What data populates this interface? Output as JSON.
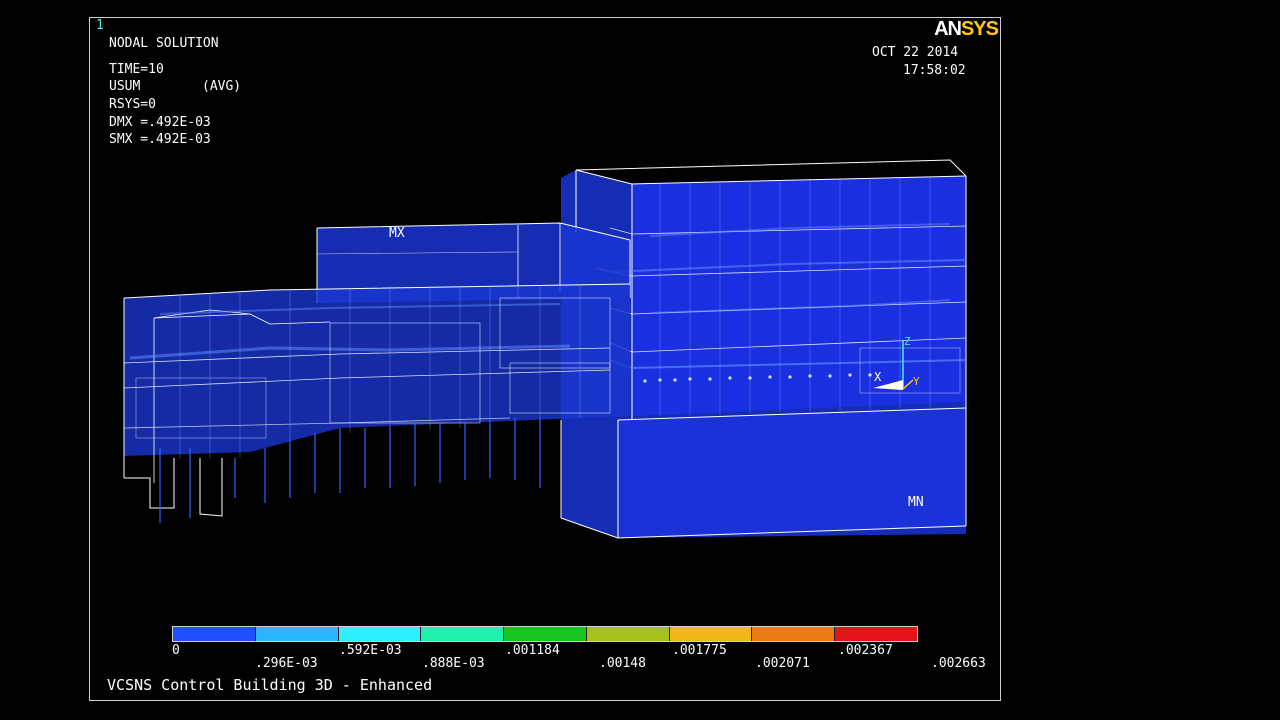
{
  "window": {
    "number": "1",
    "logo_an": "AN",
    "logo_sys": "SYS"
  },
  "header": {
    "title": "NODAL SOLUTION",
    "time": "TIME=10",
    "usum": "USUM",
    "avg": "(AVG)",
    "rsys": "RSYS=0",
    "dmx": "DMX =.492E-03",
    "smx": "SMX =.492E-03",
    "date": "OCT 22 2014",
    "clock": "17:58:02"
  },
  "markers": {
    "max": "MX",
    "min": "MN",
    "axis_x": "X",
    "axis_y": "Y",
    "axis_z": "Z"
  },
  "legend": {
    "colors": [
      "#1f4fff",
      "#29b7ff",
      "#2cf0ff",
      "#1ff0b0",
      "#14c61e",
      "#a6c21d",
      "#f1b617",
      "#ee7a15",
      "#e5141b"
    ],
    "labels_bottom_row": [
      "0",
      ".592E-03",
      ".001184",
      ".001775",
      ".002367"
    ],
    "labels_top_row": [
      ".296E-03",
      ".888E-03",
      ".00148",
      ".002071",
      ".002663"
    ]
  },
  "footer": {
    "model_title": "VCSNS Control Building 3D - Enhanced"
  },
  "colors": {
    "model_fill": "#1a2fd6",
    "wire": "#ffffff",
    "accent": "#ffc61a"
  }
}
